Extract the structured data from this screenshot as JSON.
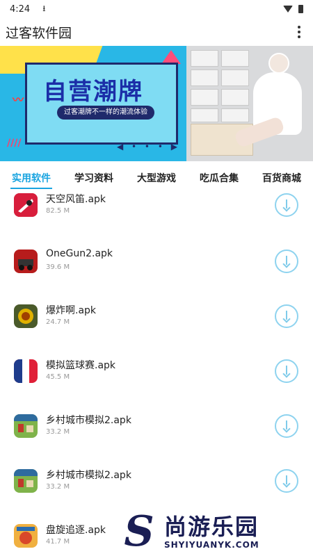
{
  "status_bar": {
    "time": "4:24"
  },
  "app_bar": {
    "title": "过客软件园"
  },
  "banner": {
    "headline": "自营潮牌",
    "tagline": "过客潮牌不一样的潮流体验"
  },
  "tabs": [
    "实用软件",
    "学习资料",
    "大型游戏",
    "吃瓜合集",
    "百货商城"
  ],
  "active_tab": "实用软件",
  "apps": [
    {
      "name": "天空风笛.apk",
      "size": "82.5 M",
      "icon": "sky-flute-app-icon"
    },
    {
      "name": "OneGun2.apk",
      "size": "39.6 M",
      "icon": "onegun2-app-icon"
    },
    {
      "name": "爆炸啊.apk",
      "size": "24.7 M",
      "icon": "explosion-app-icon"
    },
    {
      "name": "模拟篮球赛.apk",
      "size": "45.5 M",
      "icon": "basketball-app-icon"
    },
    {
      "name": "乡村城市模拟2.apk",
      "size": "33.2 M",
      "icon": "village-city-app-icon"
    },
    {
      "name": "乡村城市模拟2.apk",
      "size": "33.2 M",
      "icon": "village-city-app-icon"
    },
    {
      "name": "盘旋追逐.apk",
      "size": "41.7 M",
      "icon": "spiral-chase-app-icon"
    }
  ],
  "watermark": {
    "letter": "S",
    "cn": "尚游乐园",
    "en": "SHYIYUANYK.COM"
  },
  "colors": {
    "accent": "#19a4e0",
    "download_ring": "#8ed3ef",
    "banner_blue": "#29b7e6",
    "banner_yellow": "#ffe14a"
  }
}
